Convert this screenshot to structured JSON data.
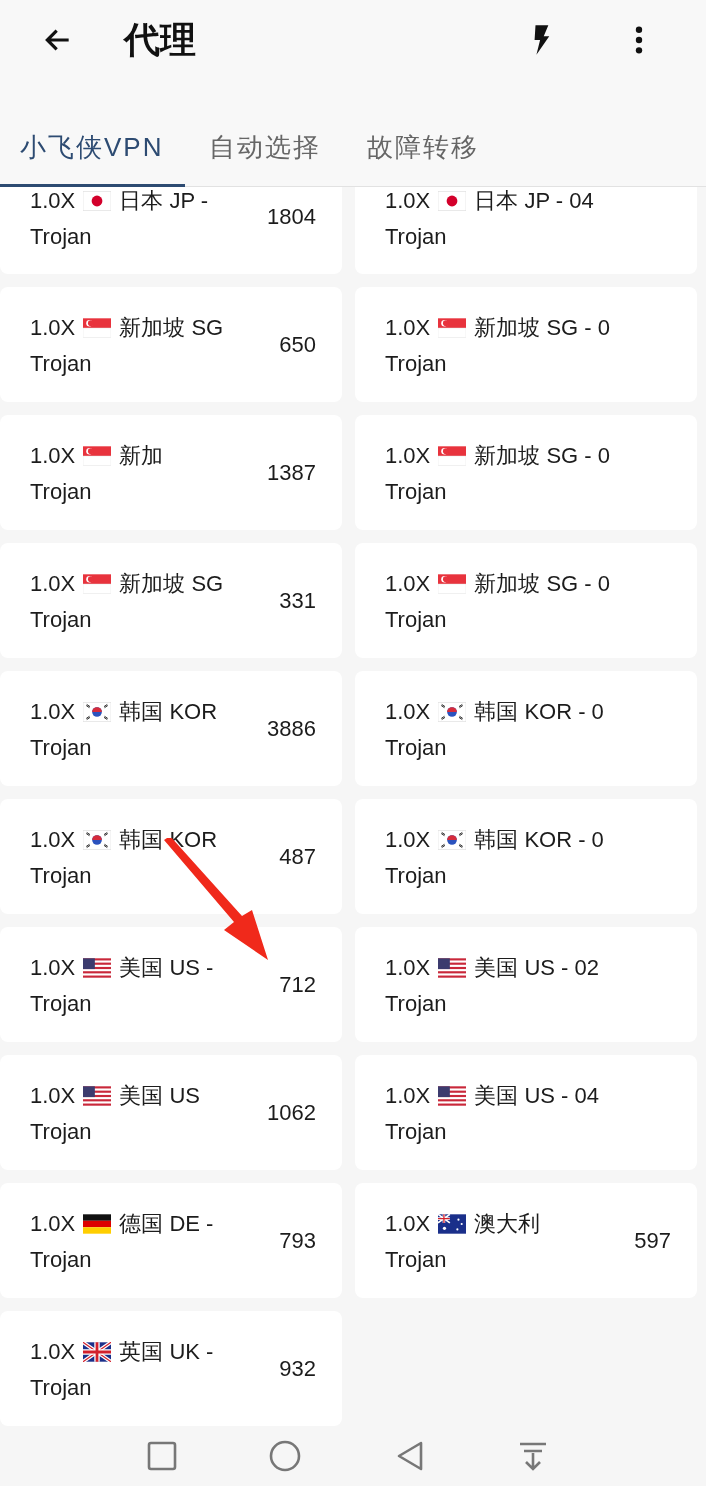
{
  "header": {
    "title": "代理"
  },
  "tabs": [
    {
      "label": "小飞侠VPN",
      "selected": true
    },
    {
      "label": "自动选择",
      "selected": false
    },
    {
      "label": "故障转移",
      "selected": false
    }
  ],
  "nodes": [
    {
      "rate": "1.0X",
      "kind": "jp",
      "name": "日本 JP -",
      "line_2": "Trojan",
      "delay": "1804"
    },
    {
      "rate": "1.0X",
      "kind": "jp",
      "name": "日本 JP - 04",
      "line_2": "Trojan"
    },
    {
      "rate": "1.0X",
      "kind": "sg",
      "name": "新加坡 SG",
      "line_2": "Trojan",
      "delay": "650"
    },
    {
      "rate": "1.0X",
      "kind": "sg",
      "name": "新加坡 SG - 0",
      "line_2": "Trojan"
    },
    {
      "rate": "1.0X",
      "kind": "sg",
      "name": "新加",
      "line_2": "Trojan",
      "delay": "1387"
    },
    {
      "rate": "1.0X",
      "kind": "sg",
      "name": "新加坡 SG - 0",
      "line_2": "Trojan"
    },
    {
      "rate": "1.0X",
      "kind": "sg",
      "name": "新加坡 SG",
      "line_2": "Trojan",
      "delay": "331"
    },
    {
      "rate": "1.0X",
      "kind": "sg",
      "name": "新加坡 SG - 0",
      "line_2": "Trojan"
    },
    {
      "rate": "1.0X",
      "kind": "kr",
      "name": "韩国 KOR",
      "line_2": "Trojan",
      "delay": "3886"
    },
    {
      "rate": "1.0X",
      "kind": "kr",
      "name": "韩国 KOR - 0",
      "line_2": "Trojan"
    },
    {
      "rate": "1.0X",
      "kind": "kr",
      "name": "韩国 KOR",
      "line_2": "Trojan",
      "delay": "487"
    },
    {
      "rate": "1.0X",
      "kind": "kr",
      "name": "韩国 KOR - 0",
      "line_2": "Trojan"
    },
    {
      "rate": "1.0X",
      "kind": "us",
      "name": "美国 US -",
      "line_2": "Trojan",
      "delay": "712"
    },
    {
      "rate": "1.0X",
      "kind": "us",
      "name": "美国 US - 02",
      "line_2": "Trojan"
    },
    {
      "rate": "1.0X",
      "kind": "us",
      "name": "美国 US",
      "line_2": "Trojan",
      "delay": "1062"
    },
    {
      "rate": "1.0X",
      "kind": "us",
      "name": "美国 US - 04",
      "line_2": "Trojan"
    },
    {
      "rate": "1.0X",
      "kind": "de",
      "name": "德国 DE -",
      "line_2": "Trojan",
      "delay": "793"
    },
    {
      "rate": "1.0X",
      "kind": "au",
      "name": "澳大利",
      "line_2": "Trojan",
      "delay": "597"
    },
    {
      "rate": "1.0X",
      "kind": "uk",
      "name": "英国 UK -",
      "line_2": "Trojan",
      "delay": "932"
    }
  ]
}
